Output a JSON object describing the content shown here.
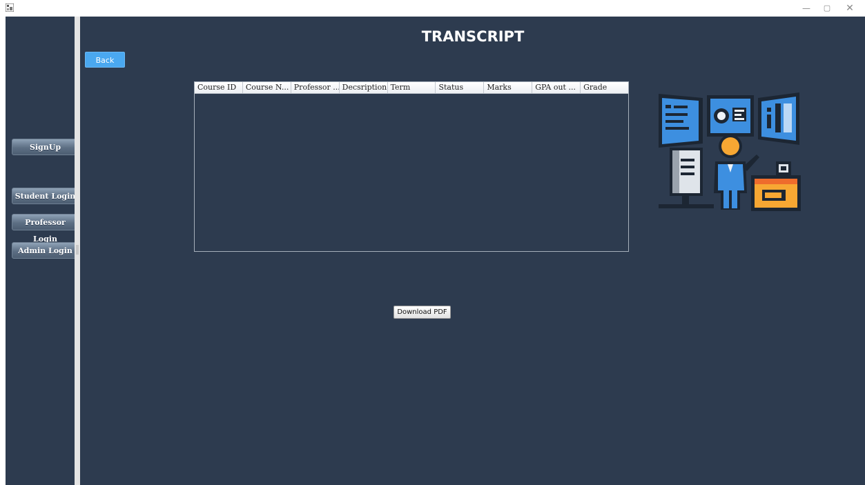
{
  "window": {
    "controls": {
      "minimize": "—",
      "maximize": "▢",
      "close": "✕"
    }
  },
  "sidebar": {
    "buttons": [
      {
        "label": "SignUp"
      },
      {
        "label": "Student Login"
      },
      {
        "label": "Professor Login"
      },
      {
        "label": "Admin Login"
      }
    ]
  },
  "main": {
    "title": "TRANSCRIPT",
    "back_label": "Back",
    "download_label": "Download PDF"
  },
  "table": {
    "columns": [
      "Course ID",
      "Course N...",
      "Professor ...",
      "Decsription",
      "Term",
      "Status",
      "Marks",
      "GPA out ...",
      "Grade"
    ],
    "rows": []
  },
  "illustration": {
    "icon": "presenter-with-screens-illustration"
  },
  "colors": {
    "background": "#2d3b4f",
    "back_button": "#4aa8f0",
    "divider": "#e4e4e4"
  }
}
